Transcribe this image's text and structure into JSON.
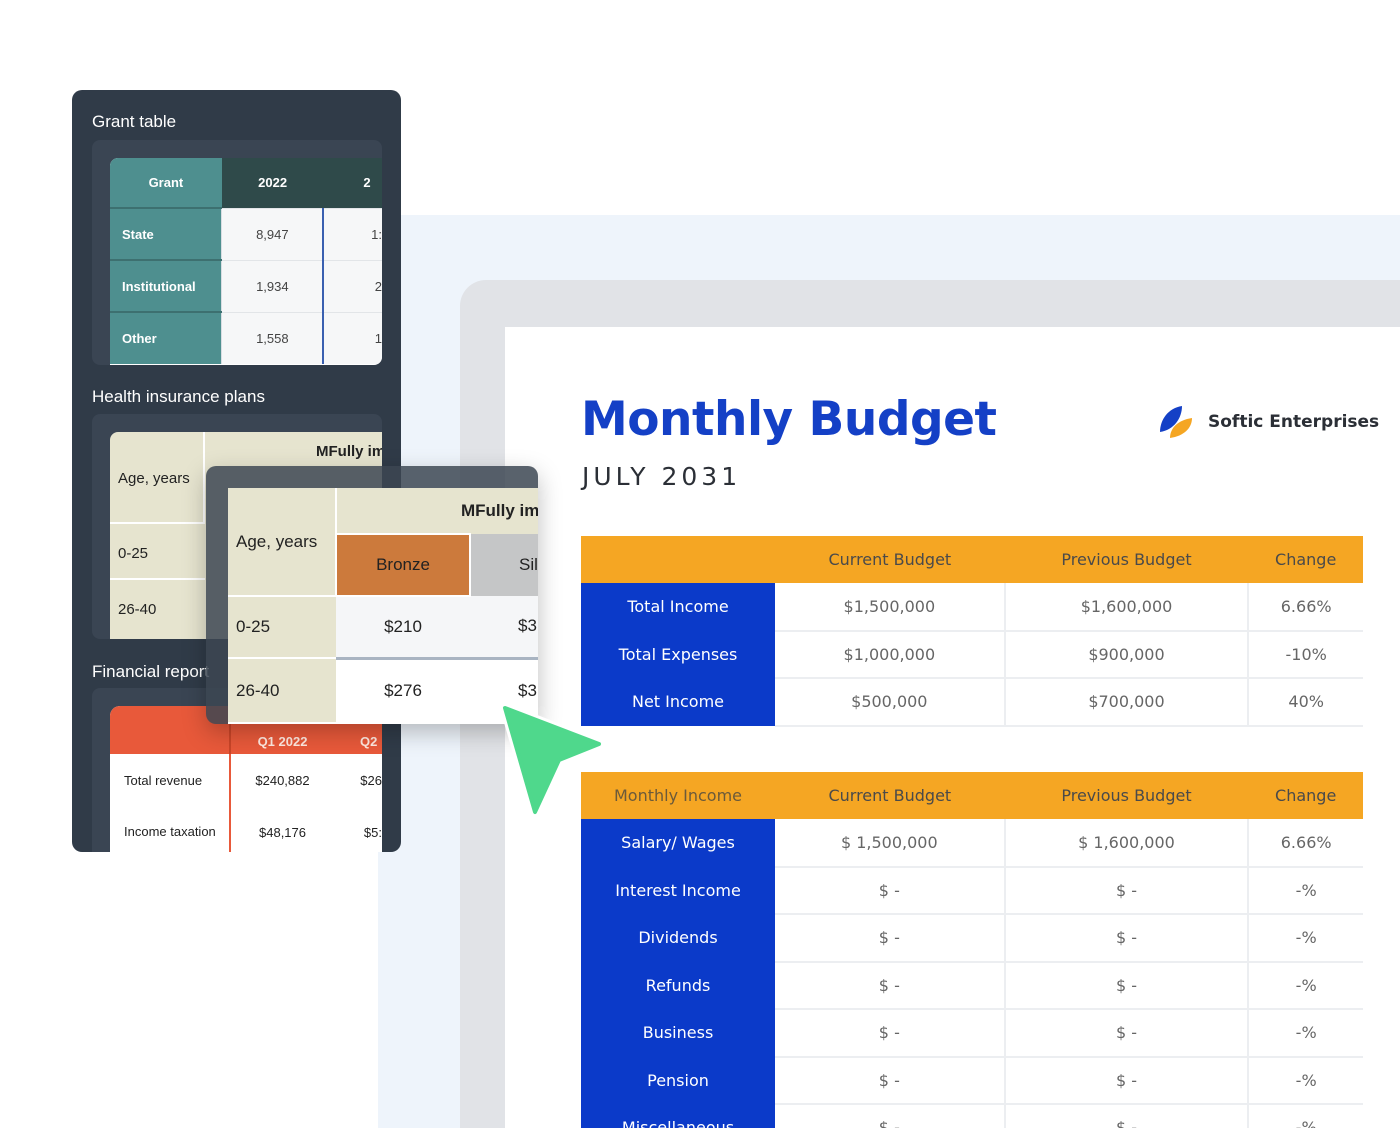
{
  "document": {
    "title": "Monthly Budget",
    "subtitle": "JULY 2031",
    "brand": "Softic Enterprises",
    "table1": {
      "headers": [
        "",
        "Current Budget",
        "Previous Budget",
        "Change"
      ],
      "rows": [
        [
          "Total Income",
          "$1,500,000",
          "$1,600,000",
          "6.66%"
        ],
        [
          "Total Expenses",
          "$1,000,000",
          "$900,000",
          "-10%"
        ],
        [
          "Net Income",
          "$500,000",
          "$700,000",
          "40%"
        ]
      ]
    },
    "table2": {
      "headers": [
        "Monthly Income",
        "Current Budget",
        "Previous Budget",
        "Change"
      ],
      "rows": [
        [
          "Salary/ Wages",
          "$ 1,500,000",
          "$ 1,600,000",
          "6.66%"
        ],
        [
          "Interest Income",
          "$ -",
          "$ -",
          "-%"
        ],
        [
          "Dividends",
          "$ -",
          "$ -",
          "-%"
        ],
        [
          "Refunds",
          "$ -",
          "$ -",
          "-%"
        ],
        [
          "Business",
          "$ -",
          "$ -",
          "-%"
        ],
        [
          "Pension",
          "$ -",
          "$ -",
          "-%"
        ],
        [
          "Miscellaneous",
          "$ -",
          "$ -",
          "-%"
        ]
      ]
    }
  },
  "sidebar": {
    "sections": {
      "grant_title": "Grant table",
      "health_title": "Health insurance plans",
      "financial_title": "Financial report"
    },
    "grant": {
      "headers": [
        "Grant",
        "2022",
        "2"
      ],
      "rows": [
        [
          "State",
          "8,947",
          "1:"
        ],
        [
          "Institutional",
          "1,934",
          "2"
        ],
        [
          "Other",
          "1,558",
          "1"
        ]
      ]
    },
    "health": {
      "age_header": "Age, years",
      "plan_header": "MFully im",
      "rows": [
        "0-25",
        "26-40"
      ]
    },
    "financial": {
      "headers": [
        "",
        "Q1 2022",
        "Q2"
      ],
      "rows": [
        [
          "Total revenue",
          "$240,882",
          "$26"
        ],
        [
          "Income taxation",
          "$48,176",
          "$5:"
        ]
      ]
    }
  },
  "zoom": {
    "age_header": "Age, years",
    "plan_header": "MFully im",
    "tiers": [
      "Bronze",
      "Sil"
    ],
    "rows": [
      [
        "0-25",
        "$210",
        "$3"
      ],
      [
        "26-40",
        "$276",
        "$3"
      ]
    ]
  },
  "colors": {
    "title_blue": "#1440c6",
    "header_orange": "#f5a623",
    "label_blue": "#0b3ac9",
    "cursor_green": "#4fd88c"
  }
}
